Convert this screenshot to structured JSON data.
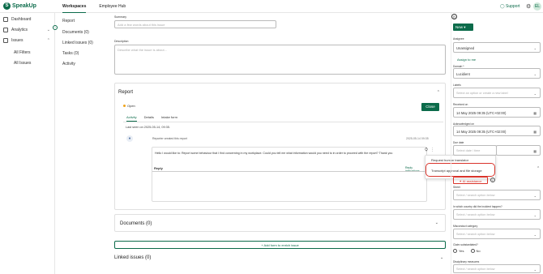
{
  "app": {
    "name": "SpeakUp"
  },
  "topnav": {
    "workspaces": "Workspaces",
    "employee_hub": "Employee Hub",
    "support": "Support",
    "avatar": "EL"
  },
  "sidebar": {
    "dashboard": "Dashboard",
    "analytics": "Analytics",
    "issues": "Issues",
    "all_filters": "All Filters",
    "all_issues": "All Issues"
  },
  "subtabs": [
    "Report",
    "Documents (0)",
    "Linked issues (0)",
    "Tasks (0)",
    "Activity"
  ],
  "summary": {
    "label": "Summary",
    "placeholder": "Add a few words about this issue"
  },
  "description": {
    "label": "Description",
    "placeholder": "Describe what the issue is about..."
  },
  "report": {
    "title": "Report",
    "status": "Open",
    "close_label": "Close",
    "tabs": [
      "Activity",
      "Details",
      "Intake form"
    ],
    "last_seen": "Last seen on 2025-05-14, 09:35.",
    "created_text": "Reporter created this report",
    "created_time": "2025-05-14 09:35",
    "message": "Hello I would like to: Report some behaviour that I find concerning in my workplace. Could you tell me what information would you need to in order to proceed with the report? Thank you",
    "reply_label": "Reply",
    "reply_instructions": "Reply instructions"
  },
  "message_menu": {
    "items": [
      "Request human translator",
      "Transcript approval and file storage"
    ]
  },
  "documents": {
    "title": "Documents (0)"
  },
  "add_form": "+ Add form to enrich issue",
  "linked_issues": "Linked issues (0)",
  "right_panel": {
    "new_label": "New",
    "assignee": {
      "label": "Assignee",
      "value": "Unassigned"
    },
    "assign_to_me": "Assign to me",
    "domain": {
      "label": "Domain *",
      "value": "Lucidient"
    },
    "labels": {
      "label": "Labels",
      "placeholder": "Select an option or create a new label"
    },
    "received_on": {
      "label": "Received on",
      "value": "14 May 2025 09:35 (UTC+02:00)"
    },
    "acknowledged_on": {
      "label": "Acknowledged on",
      "value": "14 May 2025 09:35 (UTC+02:00)"
    },
    "due_date": {
      "label": "Due date",
      "placeholder": "Select date / time"
    },
    "ai_assistance": "AI assistance",
    "street": {
      "label": "Street",
      "placeholder": "Select / search option below"
    },
    "country": {
      "label": "In which country did the incident happen?",
      "placeholder": "Select / search option below"
    },
    "misconduct": {
      "label": "Misconduct category",
      "placeholder": "Select / search option below"
    },
    "substantiated": {
      "label": "Claim substantiated?",
      "yes": "Yes",
      "no": "No"
    },
    "disciplinary": {
      "label": "Disciplinary measures",
      "placeholder": "Select / search option below"
    }
  }
}
